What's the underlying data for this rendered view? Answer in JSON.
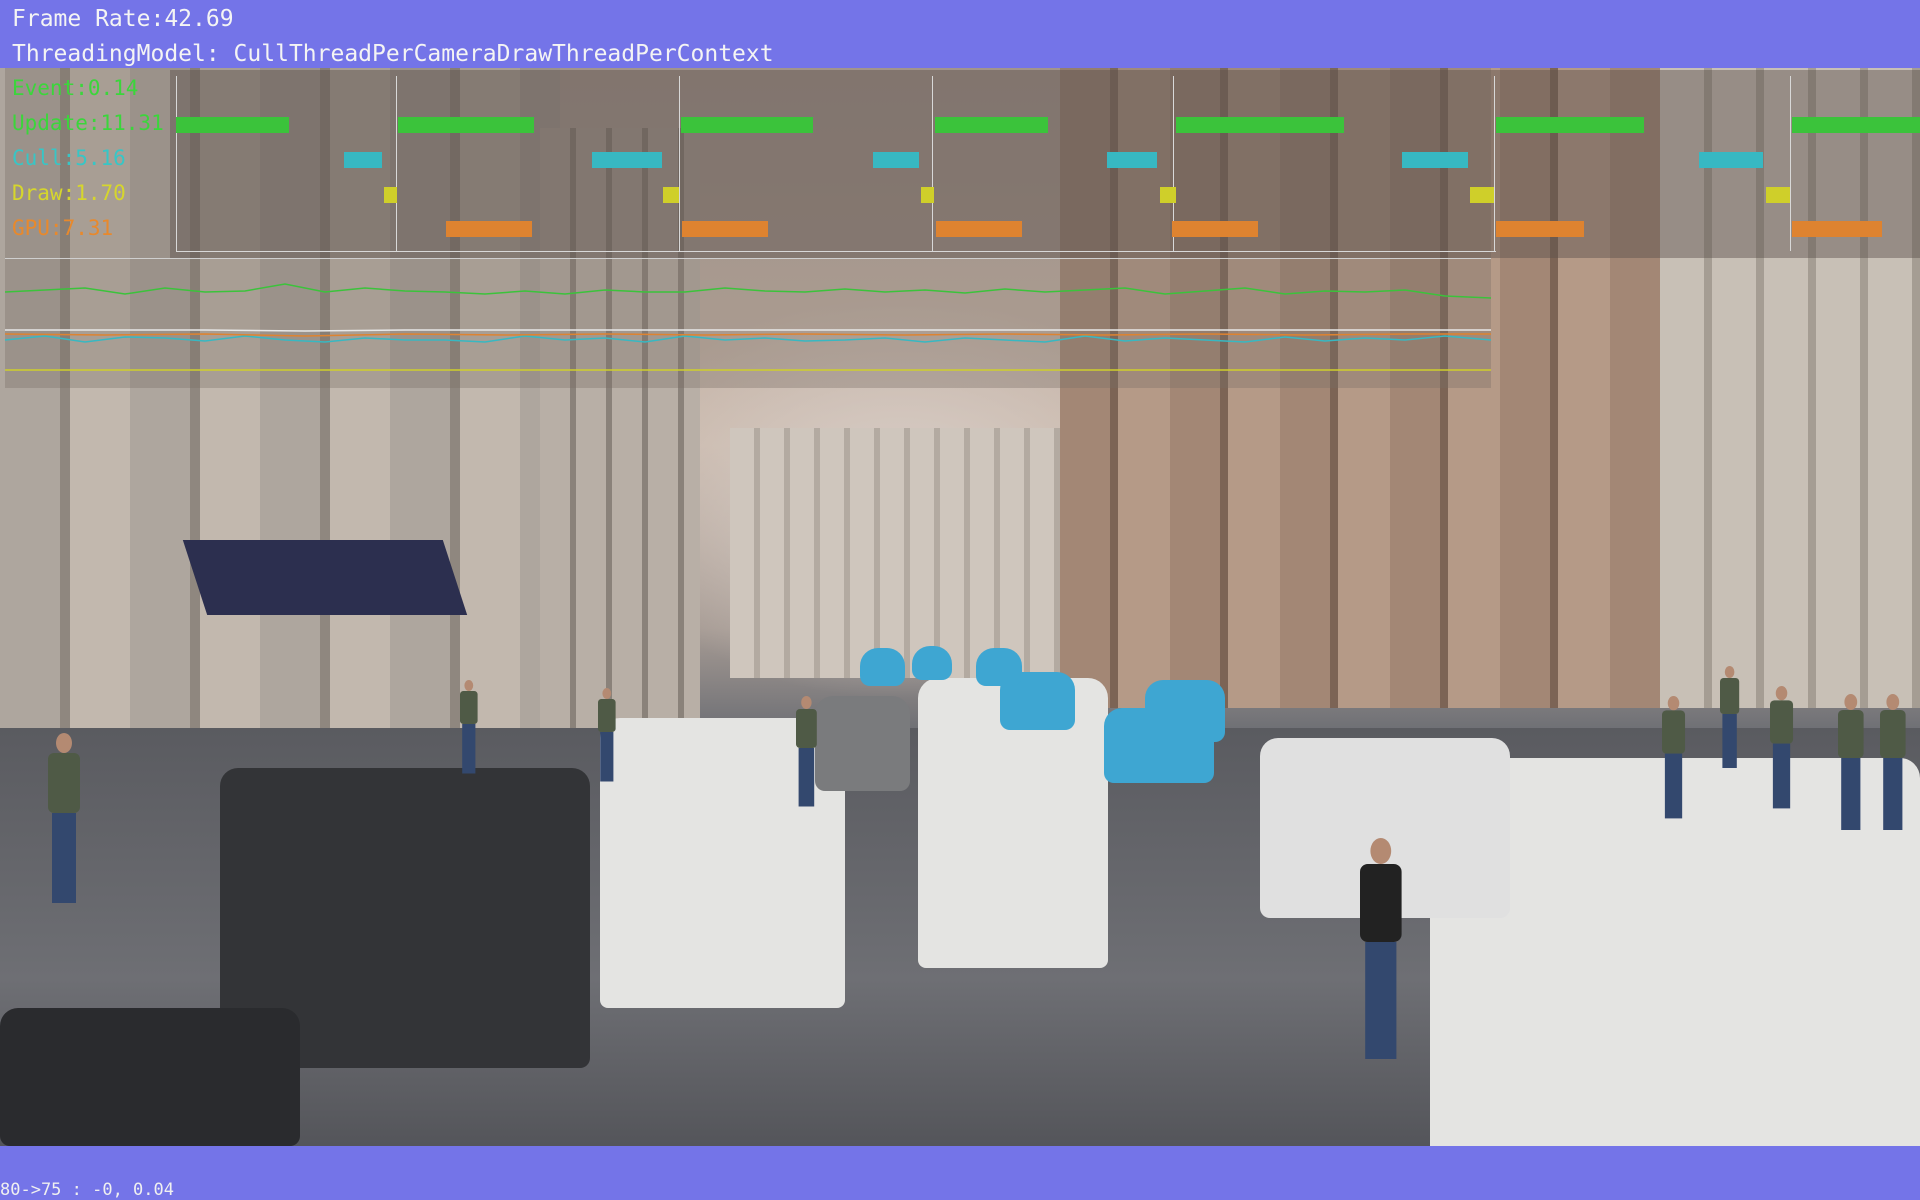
{
  "header": {
    "frame_rate": "Frame Rate:42.69",
    "threading_model": "ThreadingModel: CullThreadPerCameraDrawThreadPerContext"
  },
  "stats": [
    {
      "label": "Event:0.14",
      "color": "#3bd63b"
    },
    {
      "label": "Update:11.31",
      "color": "#3bd63b"
    },
    {
      "label": "Cull:5.16",
      "color": "#37c6c6"
    },
    {
      "label": "Draw:1.70",
      "color": "#d6d62c"
    },
    {
      "label": "GPU:7.31",
      "color": "#e8892c"
    }
  ],
  "bottom": {
    "readout": "80->75 : -0, 0.04"
  },
  "scene": {
    "description_icon": "street-scene-icon"
  }
}
